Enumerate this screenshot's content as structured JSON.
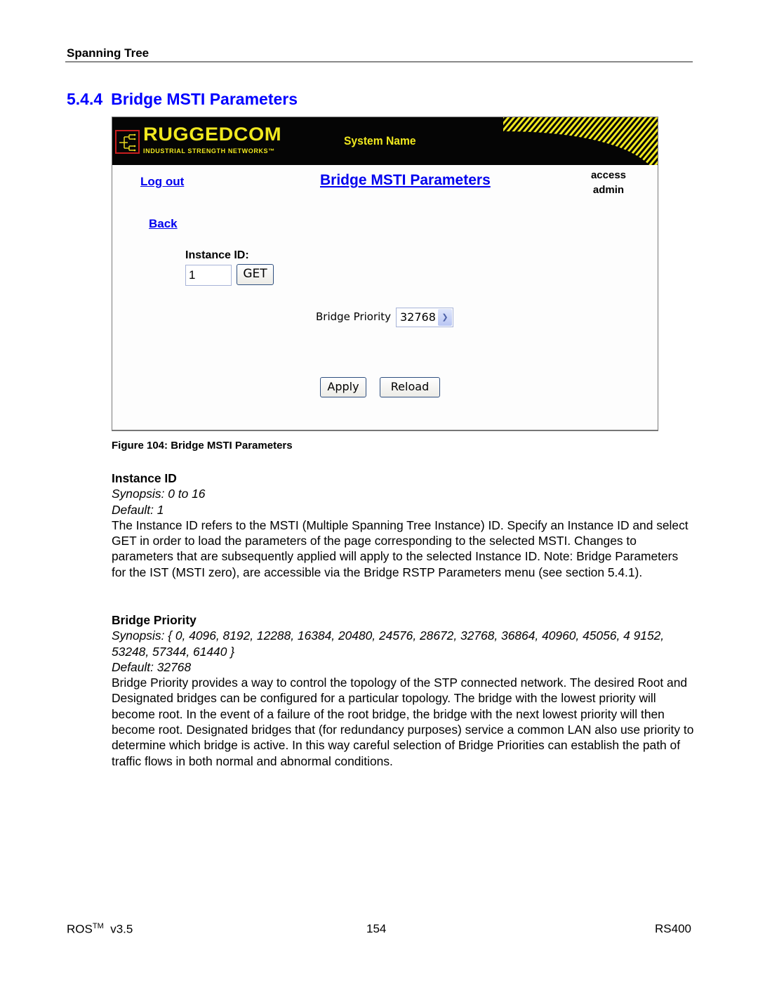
{
  "running_header": "Spanning Tree",
  "section": {
    "number": "5.4.4",
    "title": "Bridge MSTI Parameters"
  },
  "figure": {
    "banner": {
      "logo_text": "RUGGEDCOM",
      "logo_tagline": "INDUSTRIAL STRENGTH NETWORKS™",
      "system_name": "System Name",
      "brand_color": "#f0e81e",
      "banner_background": "#050505"
    },
    "logout_label": "Log out",
    "page_heading": "Bridge MSTI Parameters",
    "access_label": "access",
    "access_value": "admin",
    "back_label": "Back",
    "instance_id_label": "Instance ID:",
    "instance_id_value": "1",
    "get_label": "GET",
    "bridge_priority_label": "Bridge Priority",
    "bridge_priority_value": "32768",
    "apply_label": "Apply",
    "reload_label": "Reload",
    "link_color": "#0000ee"
  },
  "caption": "Figure 104: Bridge MSTI Parameters",
  "params": [
    {
      "name": "Instance ID",
      "synopsis": "Synopsis: 0 to 16",
      "default": "Default: 1",
      "description": "The Instance ID refers to the MSTI (Multiple Spanning Tree Instance) ID. Specify an Instance ID and select GET in order to load the parameters of the page corresponding to the selected MSTI. Changes to parameters that are subsequently applied will apply to the selected Instance ID. Note: Bridge Parameters for the IST (MSTI zero), are accessible via the Bridge RSTP Parameters menu (see section 5.4.1)."
    },
    {
      "name": "Bridge Priority",
      "synopsis": "Synopsis: { 0, 4096, 8192, 12288, 16384, 20480, 24576, 28672, 32768, 36864, 40960, 45056, 4 9152, 53248, 57344, 61440 }",
      "default": "Default: 32768",
      "description": "Bridge Priority provides a way to control the topology of the STP connected network. The desired Root and Designated bridges can be configured for a particular topology. The bridge with the lowest priority will become root. In the event of a failure of the root bridge, the bridge with the next lowest priority will then become root. Designated bridges that (for redundancy purposes) service a common LAN also use priority to determine which bridge is active. In this way careful selection of Bridge Priorities can establish the path of traffic flows in both normal and abnormal conditions."
    }
  ],
  "footer": {
    "product": "ROS",
    "trademark": "TM",
    "version": "v3.5",
    "page_number": "154",
    "model": "RS400"
  }
}
